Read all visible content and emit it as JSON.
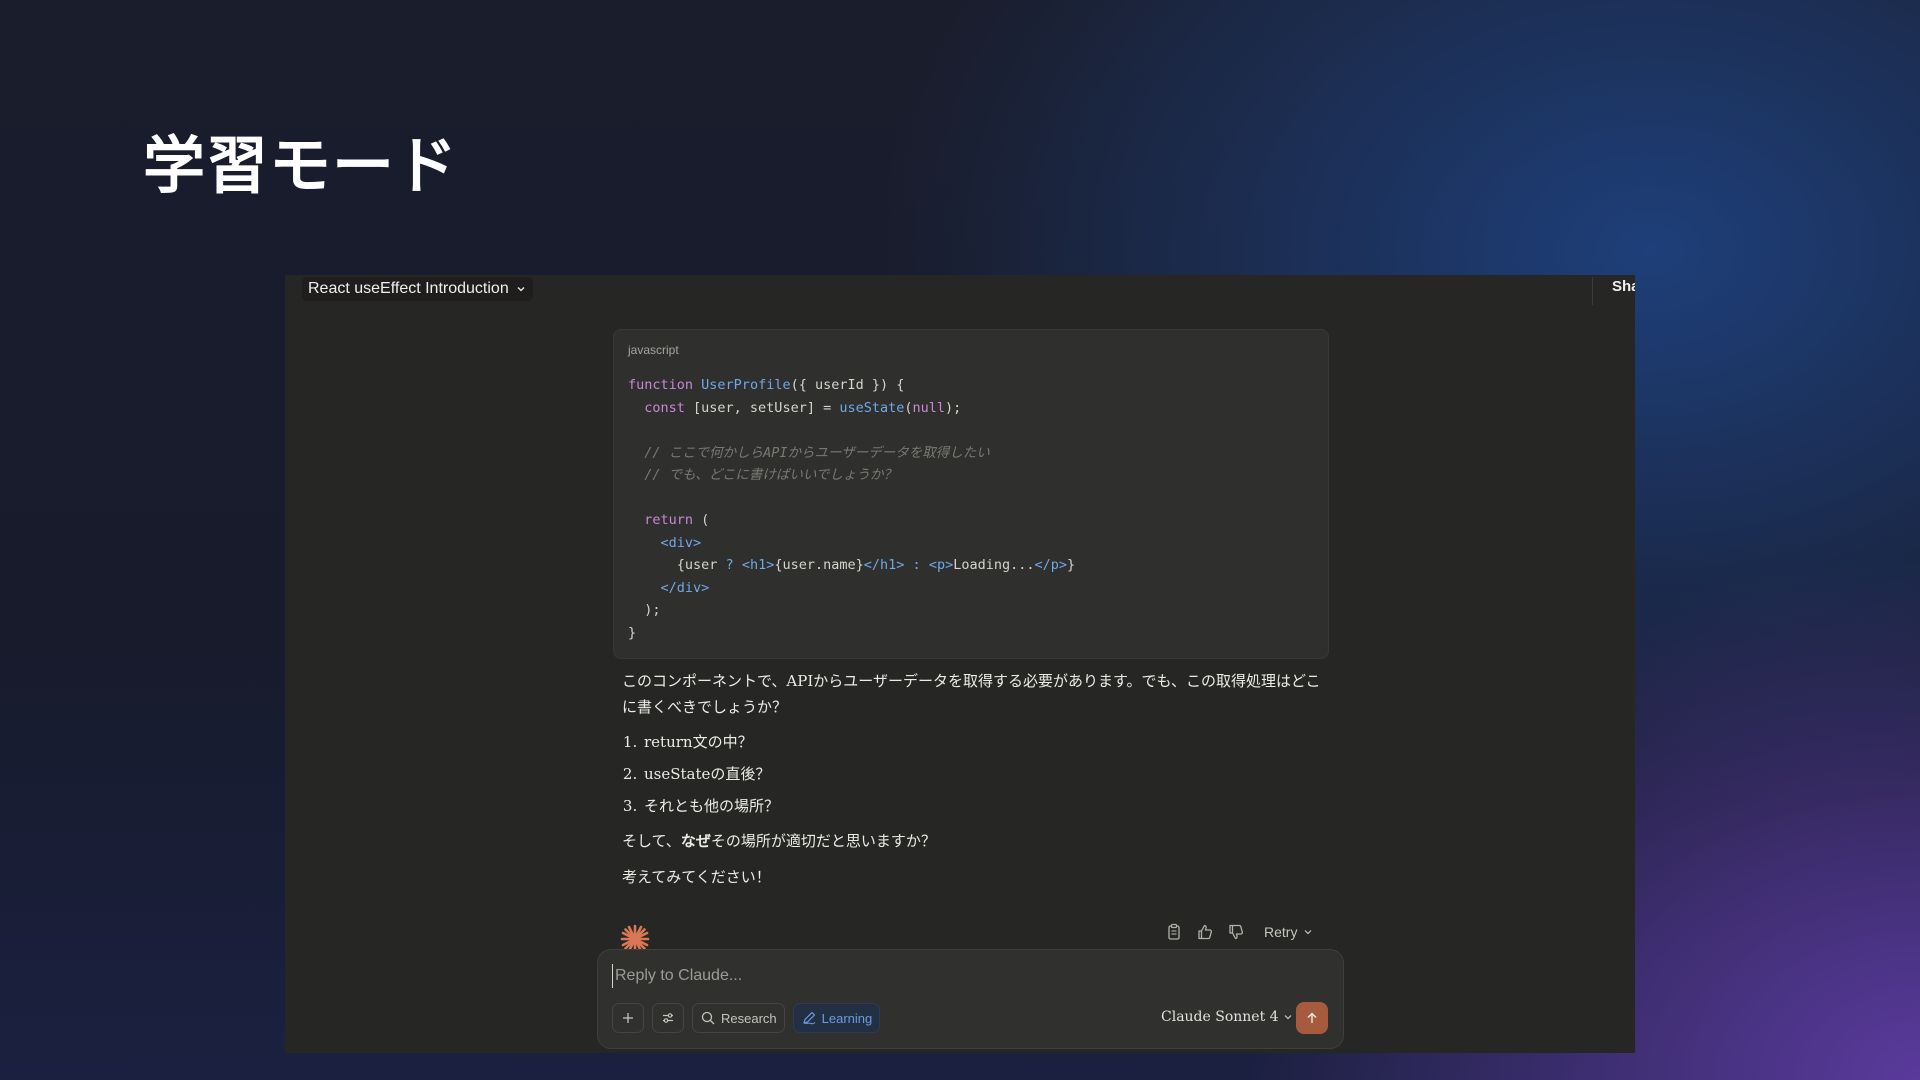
{
  "slide": {
    "title": "学習モード"
  },
  "topbar": {
    "conversation_title": "React useEffect Introduction",
    "share_label": "Sha"
  },
  "code_block": {
    "language": "javascript",
    "lines": [
      "function UserProfile({ userId }) {",
      "  const [user, setUser] = useState(null);",
      "",
      "  // ここで何かしらAPIからユーザーデータを取得したい",
      "  // でも、どこに書けばいいでしょうか？",
      "",
      "  return (",
      "    <div>",
      "      {user ? <h1>{user.name}</h1> : <p>Loading...</p>}",
      "    </div>",
      "  );",
      "}"
    ]
  },
  "message": {
    "intro": "このコンポーネントで、APIからユーザーデータを取得する必要があります。でも、この取得処理はどこに書くべきでしょうか？",
    "options": [
      "return文の中？",
      "useStateの直後？",
      "それとも他の場所？"
    ],
    "question_before": "そして、",
    "question_bold": "なぜ",
    "question_after": "その場所が適切だと思いますか？",
    "closing": "考えてみてください！"
  },
  "actions": {
    "copy_icon": "clipboard-icon",
    "thumbs_up_icon": "thumbs-up-icon",
    "thumbs_down_icon": "thumbs-down-icon",
    "retry_label": "Retry"
  },
  "composer": {
    "placeholder": "Reply to Claude...",
    "value": "",
    "research_label": "Research",
    "learning_label": "Learning",
    "model_label": "Claude Sonnet 4"
  },
  "colors": {
    "app_background": "#262624",
    "code_background": "#2f2f2d",
    "keyword": "#c987d6",
    "function": "#6fa8e6",
    "comment": "#7a7873",
    "accent_send": "#a65a3e",
    "spark": "#d97757",
    "learning_active": "#6b9be0"
  }
}
